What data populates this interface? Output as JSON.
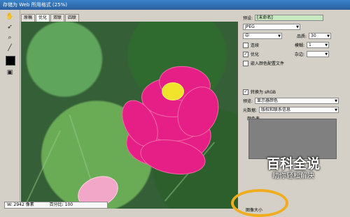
{
  "window": {
    "title": "存储为 Web 所用格式 (25%)"
  },
  "tabs": [
    "原稿",
    "优化",
    "双联",
    "四联"
  ],
  "active_tab": 1,
  "tools": [
    "hand-icon",
    "slice-select-icon",
    "zoom-icon",
    "eyedropper-icon",
    "color-swatch-icon",
    "preview-icon"
  ],
  "panel": {
    "preset_label": "预设:",
    "preset_value": "[未命名]",
    "format_value": "JPEG",
    "quality_level": "中",
    "quality_label": "品质:",
    "quality_value": "30",
    "progressive_label": "连续",
    "blur_label": "模糊:",
    "blur_value": "1",
    "optimized_label": "优化",
    "matte_label": "杂边:",
    "embed_profile_label": "嵌入颜色配置文件",
    "convert_srgb_label": "转换为 sRGB",
    "preview_label": "预览:",
    "preview_value": "显示器颜色",
    "metadata_label": "元数据:",
    "metadata_value": "版权和联系信息",
    "color_table_label": "颜色表",
    "image_size_label": "图像大小",
    "width_label": "W:",
    "width_value": "2942",
    "width_unit": "像素",
    "percent_label": "百分比:",
    "percent_value": "100"
  },
  "watermark": {
    "title": "百科全说",
    "subtitle": "助你轻松解决"
  },
  "colors": {
    "highlight_circle": "#f0ad1f",
    "titlebar": "#2a5f9e",
    "preset_field": "#c7e9c0"
  }
}
